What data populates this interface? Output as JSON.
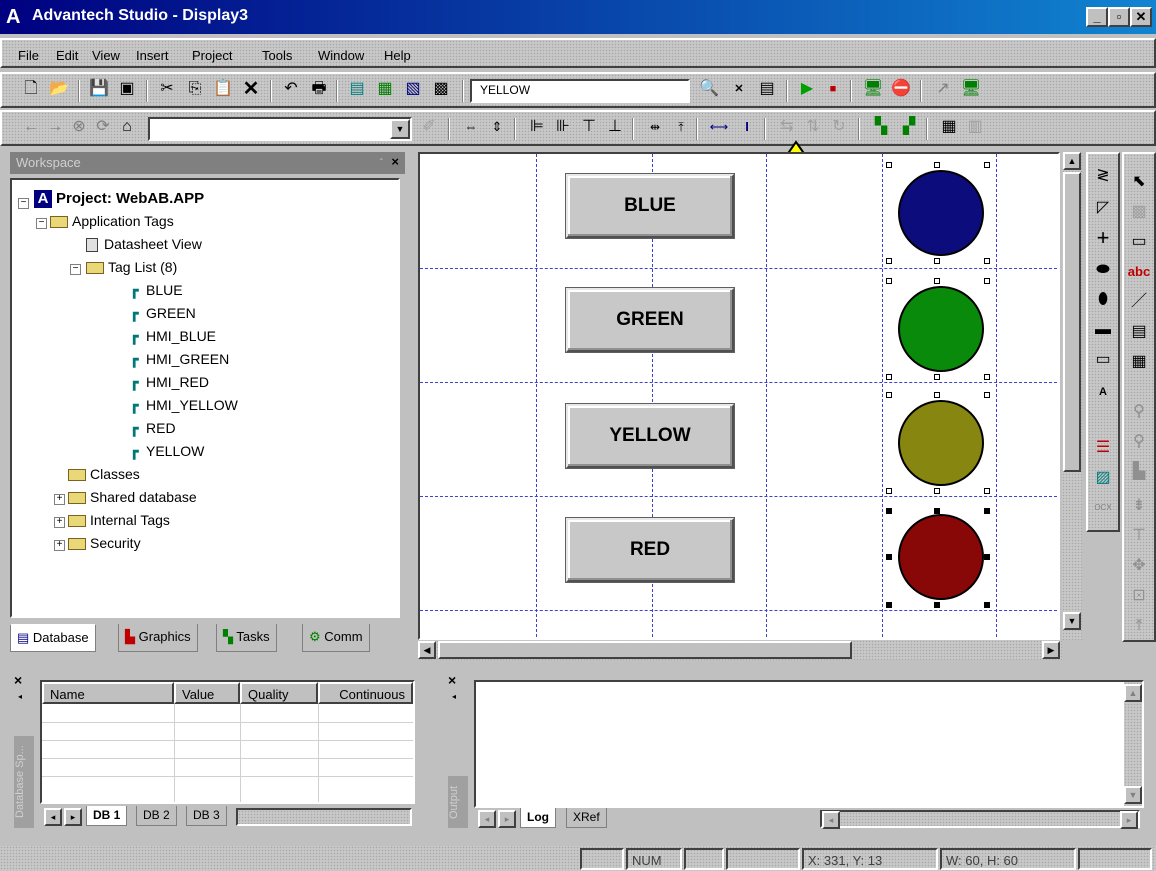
{
  "window": {
    "title": "Advantech Studio   - Display3",
    "logo": "A"
  },
  "menu": [
    "File",
    "Edit",
    "View",
    "Insert",
    "Project",
    "Tools",
    "Window",
    "Help"
  ],
  "toolbar": {
    "tag_field_value": "YELLOW",
    "nav_field_value": ""
  },
  "workspace": {
    "header": "Workspace",
    "project": "Project: WebAB.APP",
    "app_tags": "Application Tags",
    "datasheet": "Datasheet View",
    "taglist": "Tag List (8)",
    "tags": [
      "BLUE",
      "GREEN",
      "HMI_BLUE",
      "HMI_GREEN",
      "HMI_RED",
      "HMI_YELLOW",
      "RED",
      "YELLOW"
    ],
    "classes": "Classes",
    "shared_db": "Shared database",
    "internal_tags": "Internal Tags",
    "security": "Security",
    "tabs": [
      "Database",
      "Graphics",
      "Tasks",
      "Comm"
    ]
  },
  "canvas": {
    "buttons": [
      "BLUE",
      "GREEN",
      "YELLOW",
      "RED"
    ],
    "lamps": [
      "#0c0c7c",
      "#0a8a0a",
      "#868610",
      "#880808"
    ]
  },
  "database_panel": {
    "columns": [
      "Name",
      "Value",
      "Quality",
      "Continuous"
    ],
    "tabs": [
      "DB 1",
      "DB 2",
      "DB 3"
    ],
    "side_label": "Database Sp..."
  },
  "output_panel": {
    "side_label": "Output",
    "tabs": [
      "Log",
      "XRef"
    ]
  },
  "status": {
    "num": "NUM",
    "coords": "X: 331, Y: 13",
    "size": "W: 60, H: 60"
  }
}
